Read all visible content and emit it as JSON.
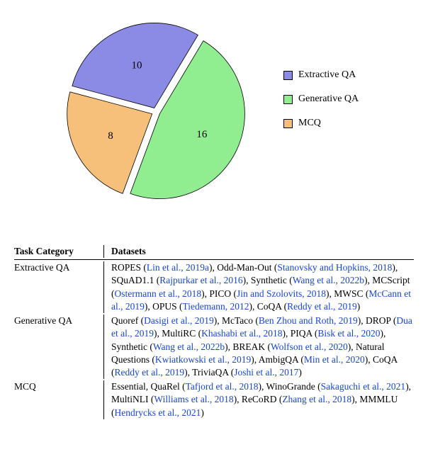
{
  "chart_data": {
    "type": "pie",
    "title": "",
    "series": [
      {
        "name": "Extractive QA",
        "value": 10,
        "color": "#8b8be6"
      },
      {
        "name": "Generative QA",
        "value": 16,
        "color": "#90ee90"
      },
      {
        "name": "MCQ",
        "value": 8,
        "color": "#f7c07a"
      }
    ],
    "legend_position": "right",
    "start_angle_deg": -165,
    "direction": "clockwise"
  },
  "legend": {
    "items": [
      {
        "label": "Extractive QA",
        "color": "#8b8be6"
      },
      {
        "label": "Generative QA",
        "color": "#90ee90"
      },
      {
        "label": "MCQ",
        "color": "#f7c07a"
      }
    ]
  },
  "table": {
    "headers": {
      "category": "Task Category",
      "datasets": "Datasets"
    },
    "rows": [
      {
        "category": "Extractive QA",
        "datasets_runs": [
          {
            "t": "ROPES (",
            "c": false
          },
          {
            "t": "Lin et al., 2019a",
            "c": true
          },
          {
            "t": "), Odd-Man-Out (",
            "c": false
          },
          {
            "t": "Stanovsky and Hopkins, 2018",
            "c": true
          },
          {
            "t": "), SQuAD1.1 (",
            "c": false
          },
          {
            "t": "Rajpurkar et al., 2016",
            "c": true
          },
          {
            "t": "), Synthetic (",
            "c": false
          },
          {
            "t": "Wang et al., 2022b",
            "c": true
          },
          {
            "t": "), MCScript (",
            "c": false
          },
          {
            "t": "Ostermann et al., 2018",
            "c": true
          },
          {
            "t": "), PICO (",
            "c": false
          },
          {
            "t": "Jin and Szolovits, 2018",
            "c": true
          },
          {
            "t": "), MWSC (",
            "c": false
          },
          {
            "t": "McCann et al., 2019",
            "c": true
          },
          {
            "t": "), OPUS (",
            "c": false
          },
          {
            "t": "Tiedemann, 2012",
            "c": true
          },
          {
            "t": "), CoQA (",
            "c": false
          },
          {
            "t": "Reddy et al., 2019",
            "c": true
          },
          {
            "t": ")",
            "c": false
          }
        ]
      },
      {
        "category": "Generative QA",
        "datasets_runs": [
          {
            "t": "Quoref (",
            "c": false
          },
          {
            "t": "Dasigi et al., 2019",
            "c": true
          },
          {
            "t": "), McTaco (",
            "c": false
          },
          {
            "t": "Ben Zhou and Roth, 2019",
            "c": true
          },
          {
            "t": "), DROP (",
            "c": false
          },
          {
            "t": "Dua et al., 2019",
            "c": true
          },
          {
            "t": "), MultiRC (",
            "c": false
          },
          {
            "t": "Khashabi et al., 2018",
            "c": true
          },
          {
            "t": "), PIQA (",
            "c": false
          },
          {
            "t": "Bisk et al., 2020",
            "c": true
          },
          {
            "t": "), Synthetic (",
            "c": false
          },
          {
            "t": "Wang et al., 2022b",
            "c": true
          },
          {
            "t": "), BREAK (",
            "c": false
          },
          {
            "t": "Wolfson et al., 2020",
            "c": true
          },
          {
            "t": "), Natural Questions (",
            "c": false
          },
          {
            "t": "Kwiatkowski et al., 2019",
            "c": true
          },
          {
            "t": "), AmbigQA (",
            "c": false
          },
          {
            "t": "Min et al., 2020",
            "c": true
          },
          {
            "t": "), CoQA (",
            "c": false
          },
          {
            "t": "Reddy et al., 2019",
            "c": true
          },
          {
            "t": "), TriviaQA (",
            "c": false
          },
          {
            "t": "Joshi et al., 2017",
            "c": true
          },
          {
            "t": ")",
            "c": false
          }
        ]
      },
      {
        "category": "MCQ",
        "datasets_runs": [
          {
            "t": "Essential, QuaRel (",
            "c": false
          },
          {
            "t": "Tafjord et al., 2018",
            "c": true
          },
          {
            "t": "), WinoGrande (",
            "c": false
          },
          {
            "t": "Sakaguchi et al., 2021",
            "c": true
          },
          {
            "t": "), MultiNLI (",
            "c": false
          },
          {
            "t": "Williams et al., 2018",
            "c": true
          },
          {
            "t": "), ReCoRD (",
            "c": false
          },
          {
            "t": "Zhang et al., 2018",
            "c": true
          },
          {
            "t": "), MMMLU (",
            "c": false
          },
          {
            "t": "Hendrycks et al., 2021",
            "c": true
          },
          {
            "t": ")",
            "c": false
          }
        ]
      }
    ]
  }
}
